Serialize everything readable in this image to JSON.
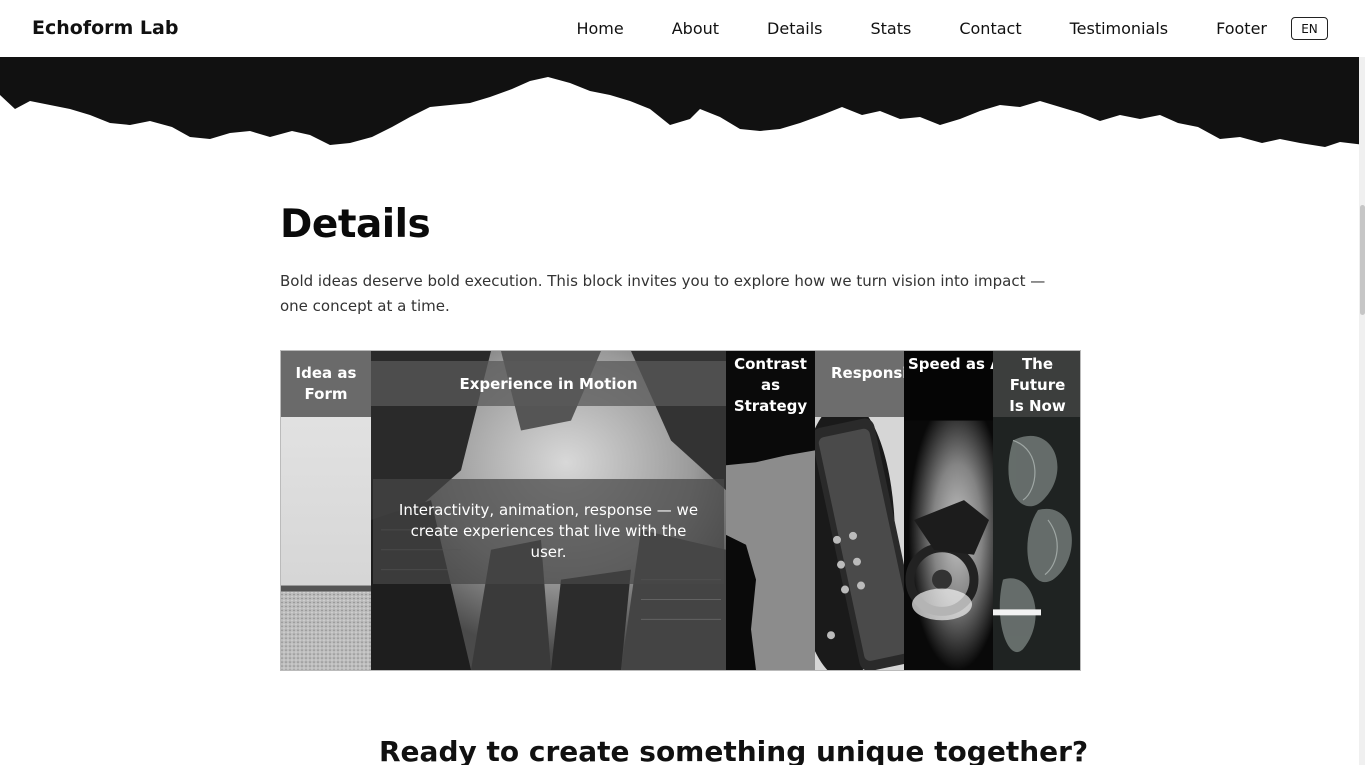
{
  "brand": "Echoform Lab",
  "nav": {
    "items": [
      "Home",
      "About",
      "Details",
      "Stats",
      "Contact",
      "Testimonials",
      "Footer"
    ],
    "lang": "EN"
  },
  "details": {
    "title": "Details",
    "description": "Bold ideas deserve bold execution. This block invites you to explore how we turn vision into impact — one concept at a time."
  },
  "accordion": {
    "panels": [
      {
        "title": "Idea as\nForm"
      },
      {
        "title": "Experience in Motion",
        "caption": "Interactivity, animation, response — we create experiences that live with the user."
      },
      {
        "title": "Contrast\nas\nStrategy"
      },
      {
        "title": "Responsive\nDesign"
      },
      {
        "title": "Speed\nas\nAdvantage"
      },
      {
        "title": "The\nFuture\nIs Now"
      }
    ],
    "active_index": 1
  },
  "cta": {
    "title": "Ready to create something unique together?"
  }
}
